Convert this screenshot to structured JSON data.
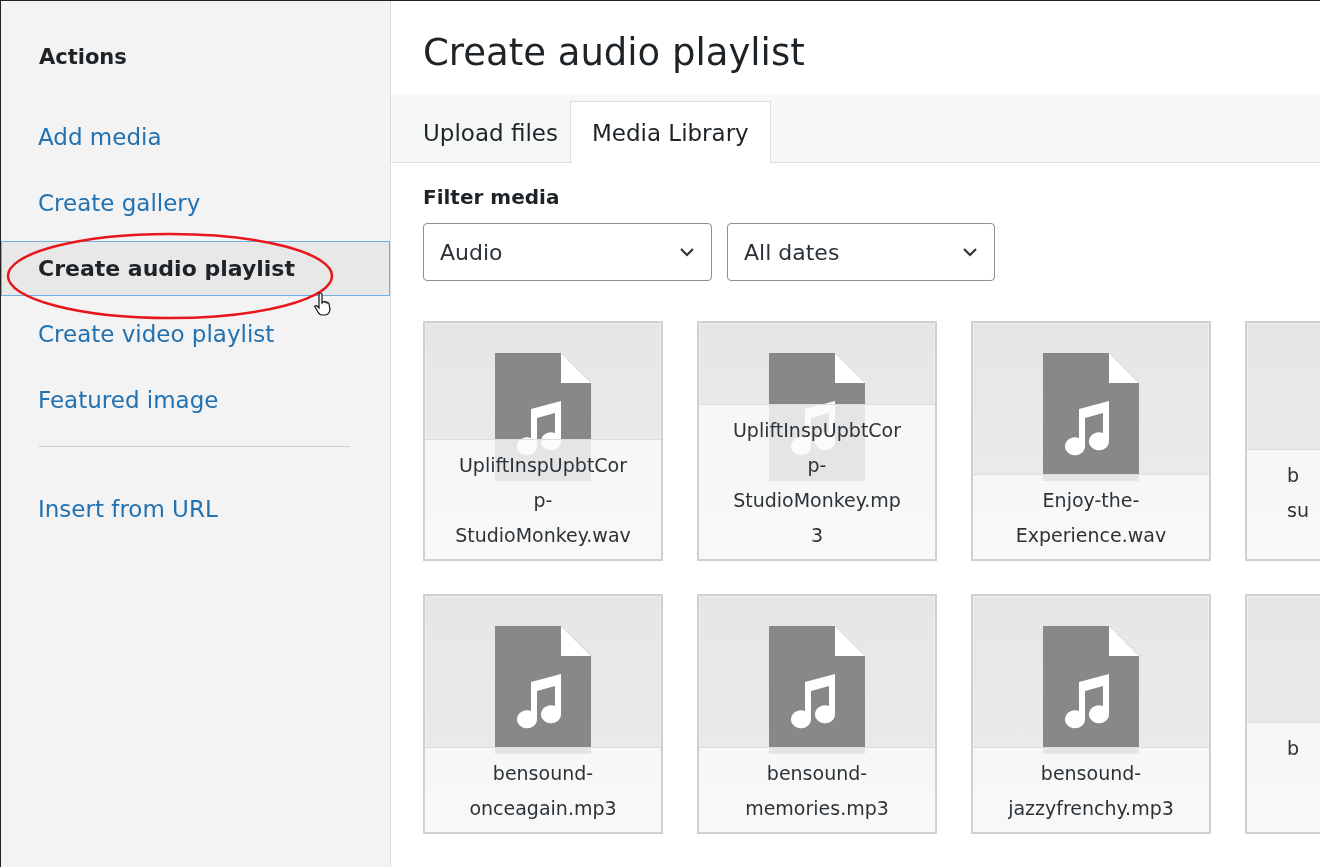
{
  "sidebar": {
    "heading": "Actions",
    "items": [
      {
        "label": "Add media",
        "selected": false
      },
      {
        "label": "Create gallery",
        "selected": false
      },
      {
        "label": "Create audio playlist",
        "selected": true
      },
      {
        "label": "Create video playlist",
        "selected": false
      },
      {
        "label": "Featured image",
        "selected": false
      }
    ],
    "extra_items": [
      {
        "label": "Insert from URL",
        "selected": false
      }
    ]
  },
  "title": "Create audio playlist",
  "tabs": [
    {
      "label": "Upload files",
      "selected": false
    },
    {
      "label": "Media Library",
      "selected": true
    }
  ],
  "filter": {
    "label": "Filter media",
    "selects": [
      {
        "value": "Audio"
      },
      {
        "value": "All dates"
      }
    ]
  },
  "tiles": [
    {
      "kind": "full",
      "lines": [
        "UpliftInspUpbtCor",
        "p-",
        "StudioMonkey.wav"
      ]
    },
    {
      "kind": "full",
      "lines": [
        "UpliftInspUpbtCor",
        "p-",
        "StudioMonkey.mp",
        "3"
      ]
    },
    {
      "kind": "full",
      "lines": [
        "Enjoy-the-",
        "Experience.wav"
      ]
    },
    {
      "kind": "partial",
      "lines": [
        "b",
        "su"
      ]
    },
    {
      "kind": "full",
      "lines": [
        "bensound-",
        "onceagain.mp3"
      ]
    },
    {
      "kind": "full",
      "lines": [
        "bensound-",
        "memories.mp3"
      ]
    },
    {
      "kind": "full",
      "lines": [
        "bensound-",
        "jazzyfrenchy.mp3"
      ]
    },
    {
      "kind": "partial",
      "lines": [
        "b"
      ]
    }
  ]
}
